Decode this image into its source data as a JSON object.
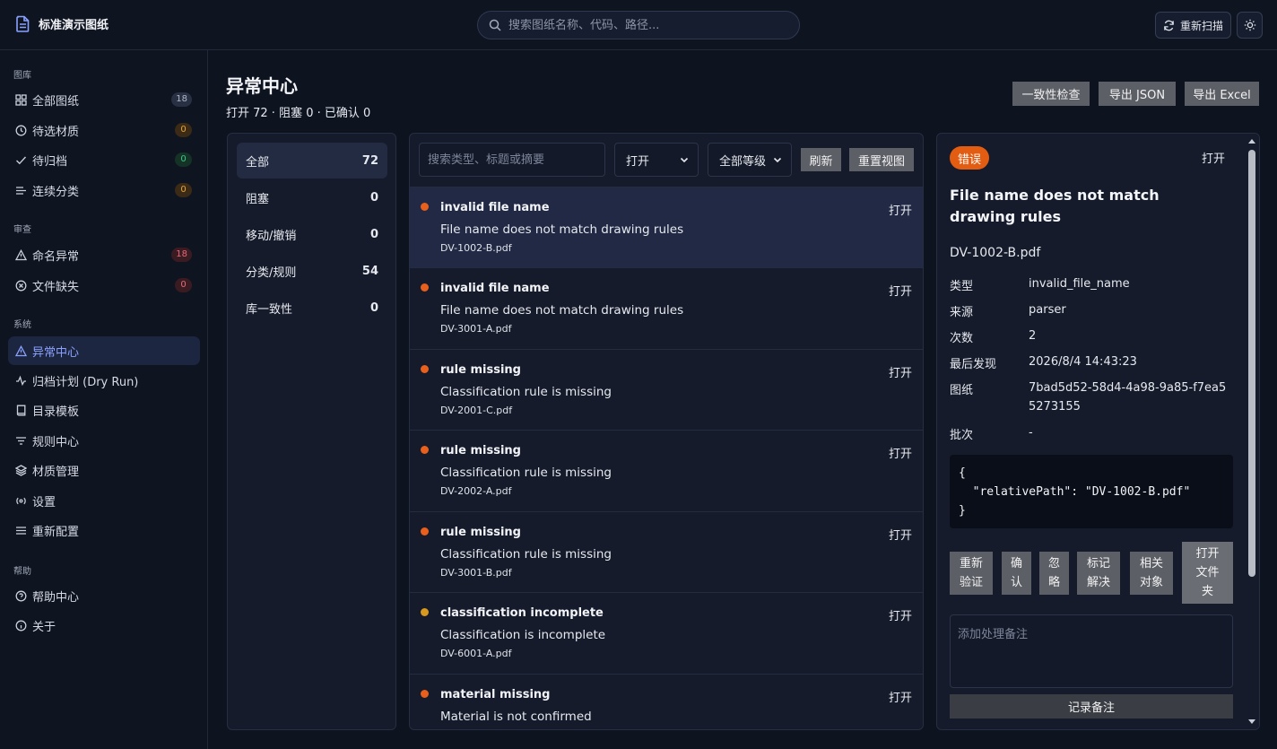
{
  "app": {
    "title": "标准演示图纸"
  },
  "search": {
    "placeholder": "搜索图纸名称、代码、路径..."
  },
  "topbar": {
    "rescan_label": "重新扫描"
  },
  "sidebar": {
    "sections": [
      {
        "title": "图库",
        "items": [
          {
            "label": "全部图纸",
            "badge": "18",
            "icon": "grid-icon"
          },
          {
            "label": "待选材质",
            "badge": "0",
            "icon": "clock-icon"
          },
          {
            "label": "待归档",
            "badge": "0",
            "icon": "check-icon"
          },
          {
            "label": "连续分类",
            "badge": "0",
            "icon": "list-filter-icon"
          }
        ]
      },
      {
        "title": "审查",
        "items": [
          {
            "label": "命名异常",
            "badge": "18",
            "icon": "warning-icon"
          },
          {
            "label": "文件缺失",
            "badge": "0",
            "icon": "x-circle-icon"
          }
        ]
      },
      {
        "title": "系统",
        "items": [
          {
            "label": "异常中心",
            "icon": "warning-icon",
            "active": true
          },
          {
            "label": "归档计划 (Dry Run)",
            "icon": "activity-icon"
          },
          {
            "label": "目录模板",
            "icon": "book-icon"
          },
          {
            "label": "规则中心",
            "icon": "filter-icon"
          },
          {
            "label": "材质管理",
            "icon": "layers-icon"
          },
          {
            "label": "设置",
            "icon": "radio-icon"
          },
          {
            "label": "重新配置",
            "icon": "menu-icon"
          }
        ]
      },
      {
        "title": "帮助",
        "items": [
          {
            "label": "帮助中心",
            "icon": "help-circle-icon"
          },
          {
            "label": "关于",
            "icon": "info-icon"
          }
        ]
      }
    ]
  },
  "page": {
    "title": "异常中心",
    "summary": "打开 72 · 阻塞 0 · 已确认 0",
    "buttons": {
      "consistency": "一致性检查",
      "export_json": "导出 JSON",
      "export_excel": "导出 Excel"
    }
  },
  "categories": [
    {
      "label": "全部",
      "count": "72",
      "active": true
    },
    {
      "label": "阻塞",
      "count": "0"
    },
    {
      "label": "移动/撤销",
      "count": "0"
    },
    {
      "label": "分类/规则",
      "count": "54"
    },
    {
      "label": "库一致性",
      "count": "0"
    }
  ],
  "filters": {
    "search_placeholder": "搜索类型、标题或摘要",
    "status_value": "打开",
    "level_value": "全部等级",
    "refresh_label": "刷新",
    "reset_label": "重置视图"
  },
  "colors": {
    "error": "#e8601c",
    "warning": "#d79a1e",
    "accent": "#8aa2ff"
  },
  "issues": [
    {
      "type": "invalid file name",
      "title": "File name does not match drawing rules",
      "file": "DV-1002-B.pdf",
      "status": "打开",
      "severity": "error",
      "active": true
    },
    {
      "type": "invalid file name",
      "title": "File name does not match drawing rules",
      "file": "DV-3001-A.pdf",
      "status": "打开",
      "severity": "error"
    },
    {
      "type": "rule missing",
      "title": "Classification rule is missing",
      "file": "DV-2001-C.pdf",
      "status": "打开",
      "severity": "error"
    },
    {
      "type": "rule missing",
      "title": "Classification rule is missing",
      "file": "DV-2002-A.pdf",
      "status": "打开",
      "severity": "error"
    },
    {
      "type": "rule missing",
      "title": "Classification rule is missing",
      "file": "DV-3001-B.pdf",
      "status": "打开",
      "severity": "error"
    },
    {
      "type": "classification incomplete",
      "title": "Classification is incomplete",
      "file": "DV-6001-A.pdf",
      "status": "打开",
      "severity": "warning"
    },
    {
      "type": "material missing",
      "title": "Material is not confirmed",
      "file": "",
      "status": "打开",
      "severity": "error"
    }
  ],
  "detail": {
    "severity_label": "错误",
    "status": "打开",
    "title": "File name does not match drawing rules",
    "file": "DV-1002-B.pdf",
    "fields": [
      {
        "key": "类型",
        "value": "invalid_file_name"
      },
      {
        "key": "来源",
        "value": "parser"
      },
      {
        "key": "次数",
        "value": "2"
      },
      {
        "key": "最后发现",
        "value": "2026/8/4 14:43:23"
      },
      {
        "key": "图纸",
        "value": "7bad5d52-58d4-4a98-9a85-f7ea55273155"
      },
      {
        "key": "批次",
        "value": "-"
      }
    ],
    "code": "{\n  \"relativePath\": \"DV-1002-B.pdf\"\n}",
    "actions": {
      "revalidate": "重新验证",
      "confirm": "确认",
      "ignore": "忽略",
      "resolve": "标记解决",
      "related": "相关对象",
      "open_folder": "打开文件夹"
    },
    "note_placeholder": "添加处理备注",
    "save_note": "记录备注"
  }
}
